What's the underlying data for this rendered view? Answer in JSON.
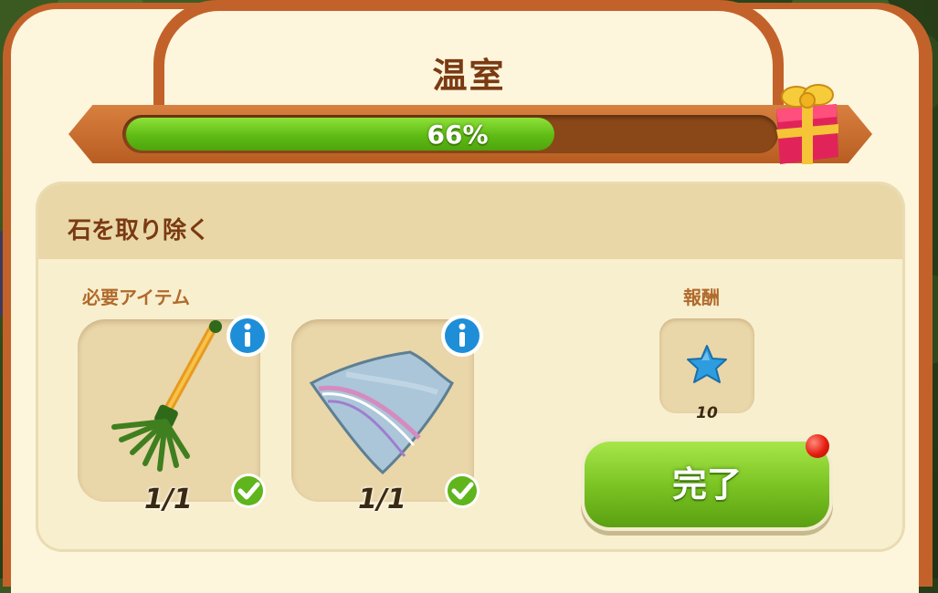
{
  "panel": {
    "title": "温室",
    "progress": {
      "percent": 66,
      "label": "66%"
    }
  },
  "task": {
    "title": "石を取り除く",
    "required_label": "必要アイテム",
    "reward_label": "報酬",
    "items": [
      {
        "name": "rake-icon",
        "count": "1/1",
        "complete": true
      },
      {
        "name": "cloth-icon",
        "count": "1/1",
        "complete": true
      }
    ],
    "reward": {
      "icon": "star-icon",
      "count": "10"
    }
  },
  "actions": {
    "complete_label": "完了",
    "has_notification": true
  },
  "colors": {
    "frame": "#c2622a",
    "panel_bg": "#fdf5dc",
    "progress_fill": "#6cc51d",
    "title_text": "#7a3a12",
    "button_green": "#7cc524",
    "info_blue": "#1e8ed8",
    "star_blue": "#2d9de0"
  }
}
